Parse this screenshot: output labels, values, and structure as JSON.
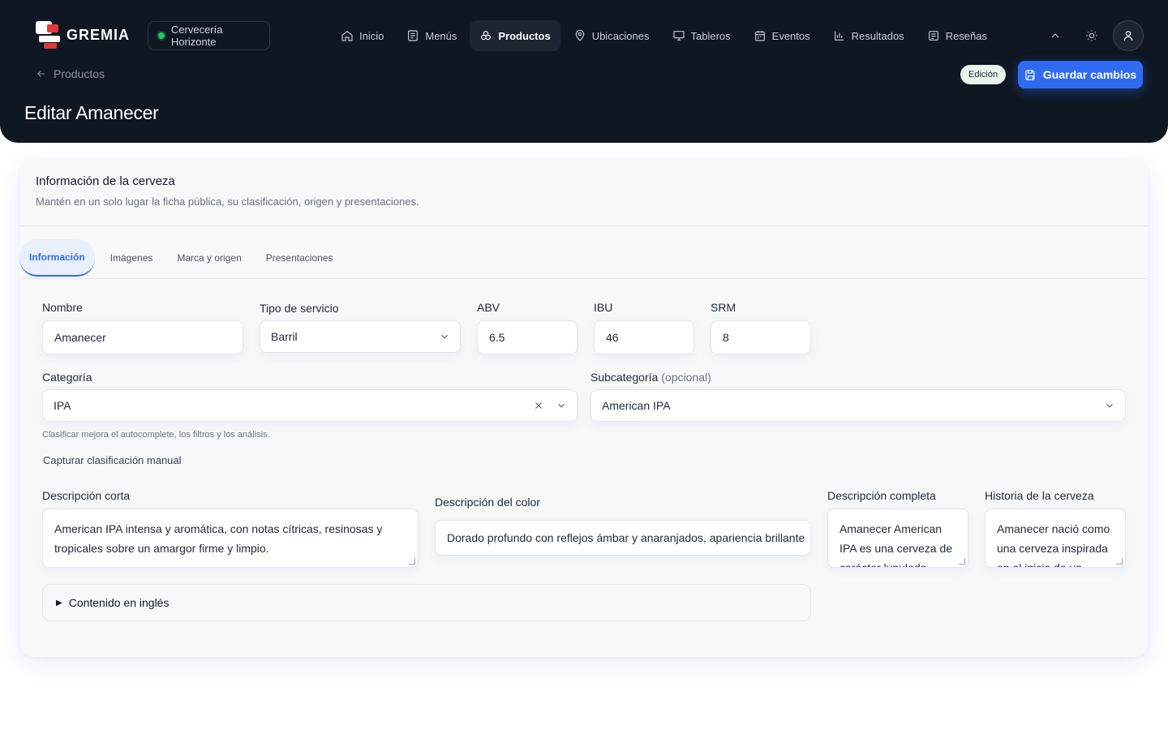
{
  "app": {
    "logo_text": "GREMIA",
    "brewery": "Cervecería Horizonte",
    "status_color": "#22c55e",
    "accent": "#2f6bf0"
  },
  "nav": [
    {
      "label": "Inicio",
      "icon": "home-icon"
    },
    {
      "label": "Menús",
      "icon": "menu-list-icon"
    },
    {
      "label": "Productos",
      "icon": "products-icon",
      "active": true
    },
    {
      "label": "Ubicaciones",
      "icon": "location-pin-icon"
    },
    {
      "label": "Tableros",
      "icon": "monitor-icon"
    },
    {
      "label": "Eventos",
      "icon": "calendar-icon"
    },
    {
      "label": "Resultados",
      "icon": "bar-chart-icon"
    },
    {
      "label": "Reseñas",
      "icon": "review-icon"
    }
  ],
  "page": {
    "back_label": "Productos",
    "title": "Editar Amanecer",
    "mode_badge": "Edición",
    "save_label": "Guardar cambios"
  },
  "card": {
    "title": "Información de la cerveza",
    "subtitle": "Mantén en un solo lugar la ficha pública, su clasificación, origen y presentaciones."
  },
  "tabs": [
    "Información",
    "Imágenes",
    "Marca y origen",
    "Presentaciones"
  ],
  "form": {
    "nombre": {
      "label": "Nombre",
      "value": "Amanecer"
    },
    "tipo": {
      "label": "Tipo de servicio",
      "value": "Barril"
    },
    "abv": {
      "label": "ABV",
      "value": "6.5"
    },
    "ibu": {
      "label": "IBU",
      "value": "46"
    },
    "srm": {
      "label": "SRM",
      "value": "8"
    },
    "categoria": {
      "label": "Categoría",
      "value": "IPA",
      "help": "Clasificar mejora el autocomplete, los filtros y los análisis."
    },
    "subcategoria": {
      "label": "Subcategoría",
      "optional": "(opcional)",
      "value": "American IPA"
    },
    "manual_link": "Capturar clasificación manual",
    "desc_corta": {
      "label": "Descripción corta",
      "value": "American IPA intensa y aromática, con notas cítricas, resinosas y tropicales sobre un amargor firme y limpio."
    },
    "desc_color": {
      "label": "Descripción del color",
      "value": "Dorado profundo con reflejos ámbar y anaranjados, apariencia brillante"
    },
    "desc_completa": {
      "label": "Descripción completa",
      "value": "Amanecer American IPA es una cerveza de carácter lupulado"
    },
    "historia": {
      "label": "Historia de la cerveza",
      "value": "Amanecer nació como una cerveza inspirada en el inicio de un"
    },
    "english": "Contenido en inglés"
  }
}
